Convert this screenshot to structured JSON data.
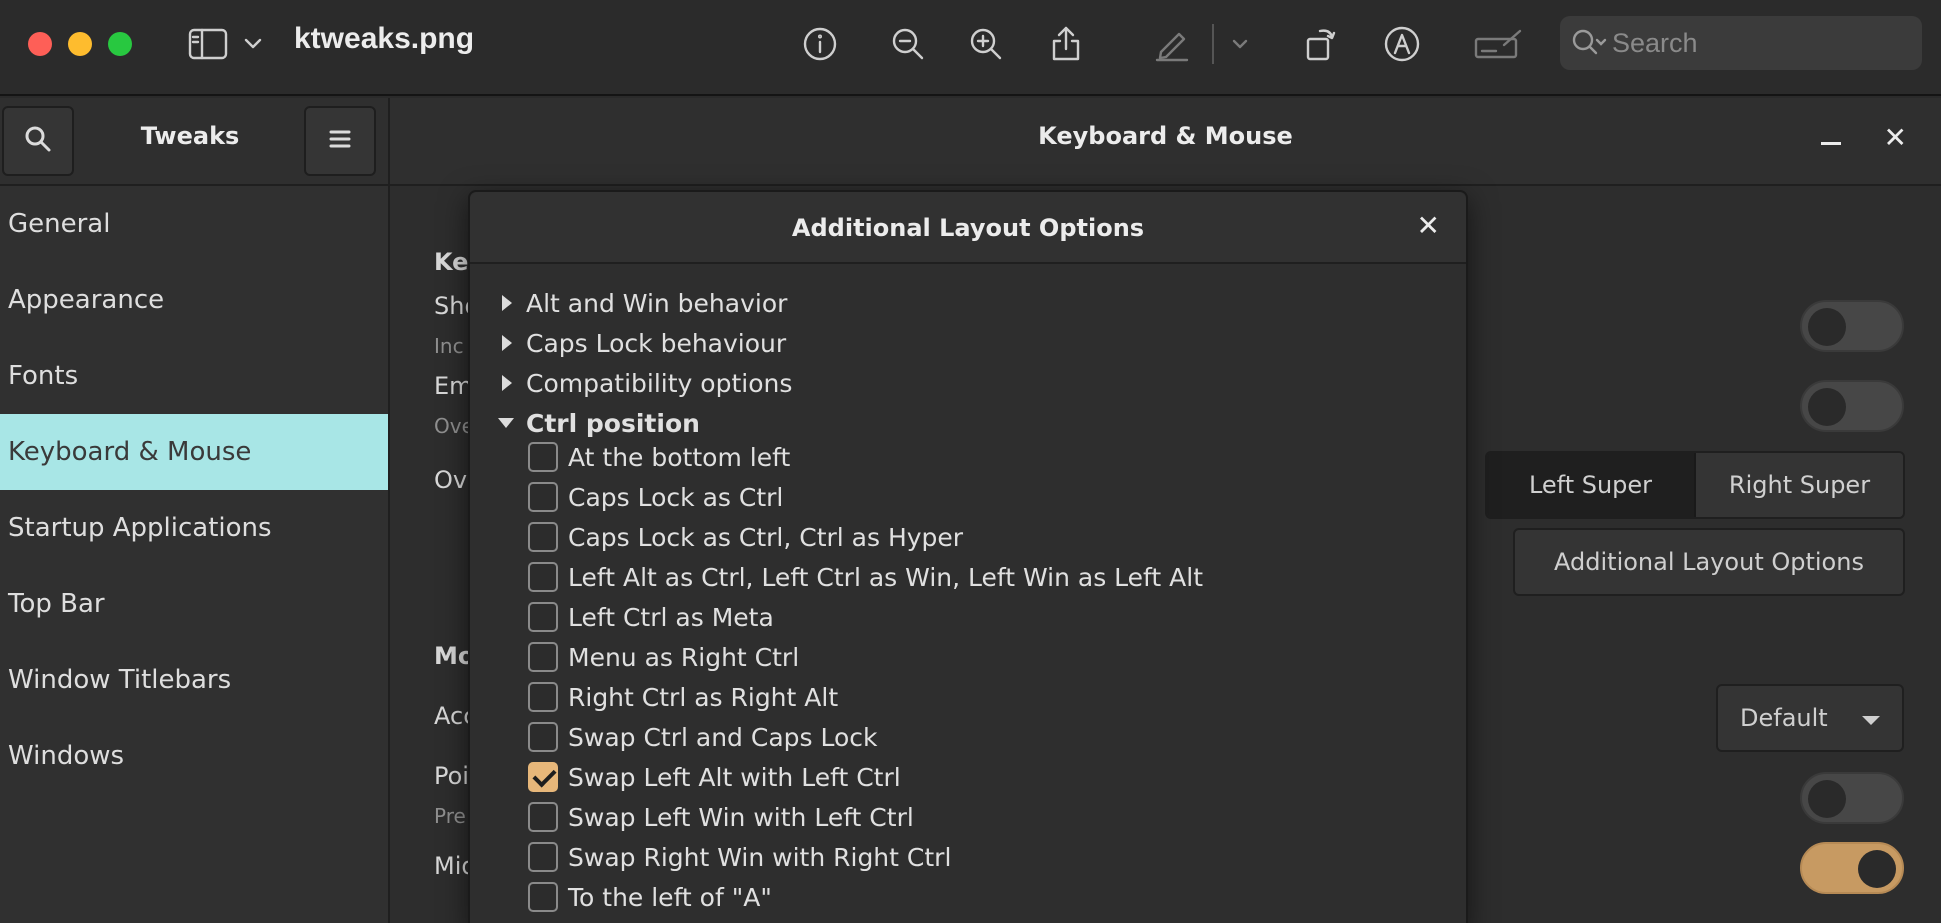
{
  "preview": {
    "filename": "ktweaks.png",
    "search_placeholder": "Search",
    "icons": [
      "close-window-icon",
      "minimize-window-icon",
      "zoom-window-icon",
      "sidebar-toggle-icon",
      "chevron-down-icon",
      "info-icon",
      "zoom-out-icon",
      "zoom-in-icon",
      "share-icon",
      "markup-pen-icon",
      "rotate-icon",
      "annotate-icon",
      "signature-icon",
      "search-icon"
    ]
  },
  "tweaks": {
    "sidebar_title": "Tweaks",
    "main_title": "Keyboard & Mouse",
    "sidebar_items": [
      {
        "label": "General"
      },
      {
        "label": "Appearance"
      },
      {
        "label": "Fonts"
      },
      {
        "label": "Keyboard & Mouse",
        "active": true
      },
      {
        "label": "Startup Applications"
      },
      {
        "label": "Top Bar"
      },
      {
        "label": "Window Titlebars"
      },
      {
        "label": "Windows"
      }
    ],
    "background_fragments": {
      "key": "Key",
      "sho": "Sho",
      "inc": "Inc",
      "em": "Em",
      "ove": "Ove",
      "ov": "Ov",
      "mo": "Mo",
      "acc": "Acc",
      "poi": "Poi",
      "pre": "Pre",
      "mid": "Mid"
    },
    "overview_shortcut": {
      "selected": "Left Super",
      "other": "Right Super"
    },
    "additional_layout_button": "Additional Layout Options",
    "acceleration_profile": "Default",
    "toggles": [
      {
        "state": "off"
      },
      {
        "state": "off"
      },
      {
        "state": "off"
      },
      {
        "state": "on"
      }
    ]
  },
  "dialog": {
    "title": "Additional Layout Options",
    "close_label": "×",
    "groups": [
      {
        "label": "Alt and Win behavior",
        "expanded": false
      },
      {
        "label": "Caps Lock behaviour",
        "expanded": false
      },
      {
        "label": "Compatibility options",
        "expanded": false
      },
      {
        "label": "Ctrl position",
        "expanded": true
      }
    ],
    "ctrl_options": [
      {
        "label": "At the bottom left",
        "checked": false
      },
      {
        "label": "Caps Lock as Ctrl",
        "checked": false
      },
      {
        "label": "Caps Lock as Ctrl, Ctrl as Hyper",
        "checked": false
      },
      {
        "label": "Left Alt as Ctrl, Left Ctrl as Win, Left Win as Left Alt",
        "checked": false
      },
      {
        "label": "Left Ctrl as Meta",
        "checked": false
      },
      {
        "label": "Menu as Right Ctrl",
        "checked": false
      },
      {
        "label": "Right Ctrl as Right Alt",
        "checked": false
      },
      {
        "label": "Swap Ctrl and Caps Lock",
        "checked": false
      },
      {
        "label": "Swap Left Alt with Left Ctrl",
        "checked": true
      },
      {
        "label": "Swap Left Win with Left Ctrl",
        "checked": false
      },
      {
        "label": "Swap Right Win with Right Ctrl",
        "checked": false
      },
      {
        "label": "To the left of \"A\"",
        "checked": false
      }
    ]
  },
  "colors": {
    "sidebar_active": "#a8e6e6",
    "accent": "#e7b77a",
    "toggle_on": "#c79a62"
  }
}
